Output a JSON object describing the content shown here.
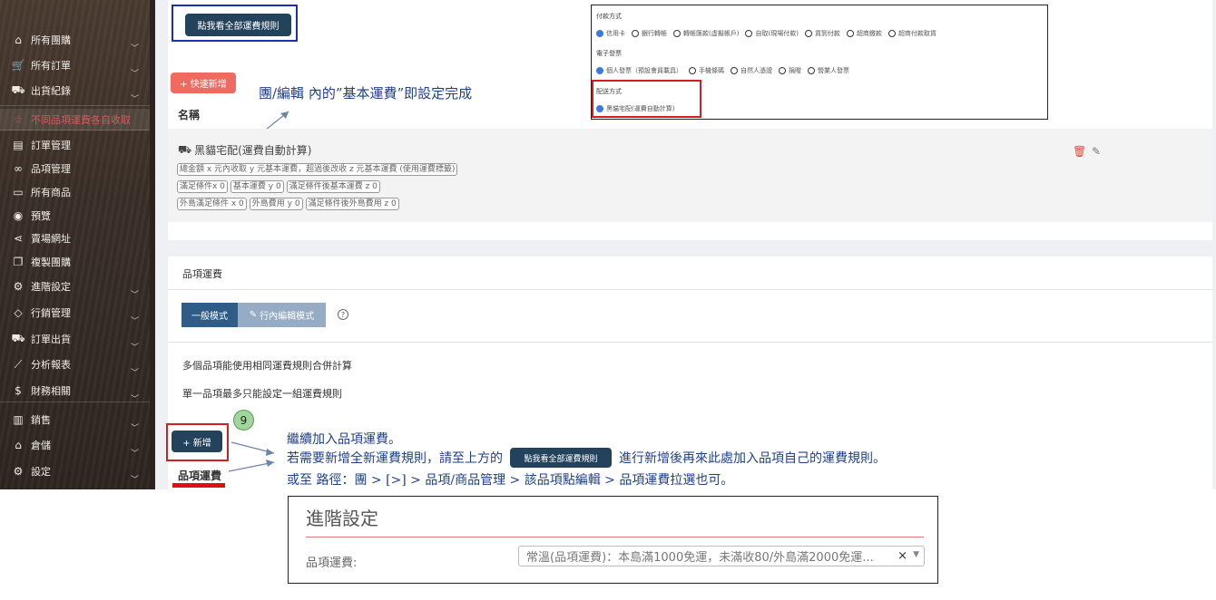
{
  "sidebar": {
    "items": [
      {
        "label": "所有團購",
        "icon": "home-icon",
        "glyph": "⌂",
        "chevron": true
      },
      {
        "label": "所有訂單",
        "icon": "cart-icon",
        "glyph": "🛒",
        "chevron": true
      },
      {
        "label": "出貨紀錄",
        "icon": "truck-icon",
        "glyph": "⛟",
        "chevron": true
      },
      {
        "label": "不同品項運費各自收取",
        "icon": "star-icon",
        "glyph": "☆",
        "chevron": false,
        "active": true
      },
      {
        "label": "訂單管理",
        "icon": "clipboard-icon",
        "glyph": "▤",
        "chevron": false
      },
      {
        "label": "品項管理",
        "icon": "glasses-icon",
        "glyph": "∞",
        "chevron": false
      },
      {
        "label": "所有商品",
        "icon": "box-icon",
        "glyph": "▭",
        "chevron": false
      },
      {
        "label": "預覽",
        "icon": "eye-icon",
        "glyph": "◉",
        "chevron": false
      },
      {
        "label": "賣場網址",
        "icon": "share-icon",
        "glyph": "⋖",
        "chevron": false
      },
      {
        "label": "複製團購",
        "icon": "copy-icon",
        "glyph": "❐",
        "chevron": false
      },
      {
        "label": "進階設定",
        "icon": "gear-icon",
        "glyph": "⚙",
        "chevron": true
      },
      {
        "label": "行銷管理",
        "icon": "tag-icon",
        "glyph": "◇",
        "chevron": true
      },
      {
        "label": "訂單出貨",
        "icon": "truck-icon",
        "glyph": "⛟",
        "chevron": true
      },
      {
        "label": "分析報表",
        "icon": "chart-line-icon",
        "glyph": "⟋",
        "chevron": true
      },
      {
        "label": "財務相關",
        "icon": "money-hand-icon",
        "glyph": "$",
        "chevron": true
      },
      {
        "label": "銷售",
        "icon": "bar-chart-icon",
        "glyph": "▥",
        "chevron": true
      },
      {
        "label": "倉儲",
        "icon": "warehouse-icon",
        "glyph": "⌂",
        "chevron": true
      },
      {
        "label": "設定",
        "icon": "gear-icon",
        "glyph": "⚙",
        "chevron": true
      }
    ]
  },
  "shipping_rules": {
    "view_all_button": "點我看全部運費規則",
    "quick_add_button": "+ 快速新增",
    "column_name": "名稱",
    "annotation": "團/編輯 內的”基本運費”即設定完成",
    "rule": {
      "title": "黑貓宅配(運費自動計算)",
      "tags_row1": [
        "總金額 x 元內收取 y 元基本運費，超過後改收 z 元基本運費 (使用運費標籤)"
      ],
      "tags_row2": [
        "滿足條件x 0",
        "基本運費 y 0",
        "滿足條件後基本運費 z 0"
      ],
      "tags_row3": [
        "外島滿足條件 x 0",
        "外島費用 y 0",
        "滿足條件後外島費用 z 0"
      ]
    }
  },
  "payment_box": {
    "payment_label": "付款方式",
    "payment_options": [
      "信用卡",
      "銀行轉帳",
      "轉帳匯款(虛擬帳戶)",
      "自取(現場付款)",
      "貨到付款",
      "超商繳款",
      "超商付款取貨"
    ],
    "invoice_label": "電子發票",
    "invoice_options": [
      "個人發票（預設會員載具）",
      "手機條碼",
      "自然人憑證",
      "捐贈",
      "營業人發票"
    ],
    "delivery_label": "配送方式",
    "delivery_options": [
      "黑貓宅配(運費自動計算)"
    ]
  },
  "item_shipping": {
    "section_title": "品項運費",
    "mode_normal": "一般模式",
    "mode_inline": "行內編輯模式",
    "help": "?",
    "info1": "多個品項能使用相同運費規則合併計算",
    "info2": "單一品項最多只能設定一組運費規則",
    "step": "9",
    "add_button": "+ 新增",
    "column_label": "品項運費",
    "annotation_line1": "繼續加入品項運費。",
    "annotation_line2_pre": "若需要新增全新運費規則，請至上方的",
    "annotation_line2_btn": "點我看全部運費規則",
    "annotation_line2_post": "進行新增後再來此處加入品項自己的運費規則。",
    "annotation_line3": "或至 路徑：團 > [>] > 品項/商品管理 > 該品項點編輯 > 品項運費拉選也可。"
  },
  "advanced_settings": {
    "title": "進階設定",
    "field_label": "品項運費:",
    "field_value": "常溫(品項運費)：本島滿1000免運，未滿收80/外島滿2000免運...",
    "clear": "×",
    "dropdown": "▼"
  },
  "colors": {
    "accent_dark": "#23425c",
    "annotation_blue": "#1f3f8a",
    "highlight_red": "#d21f1f",
    "quick_add": "#ef6a5f"
  }
}
